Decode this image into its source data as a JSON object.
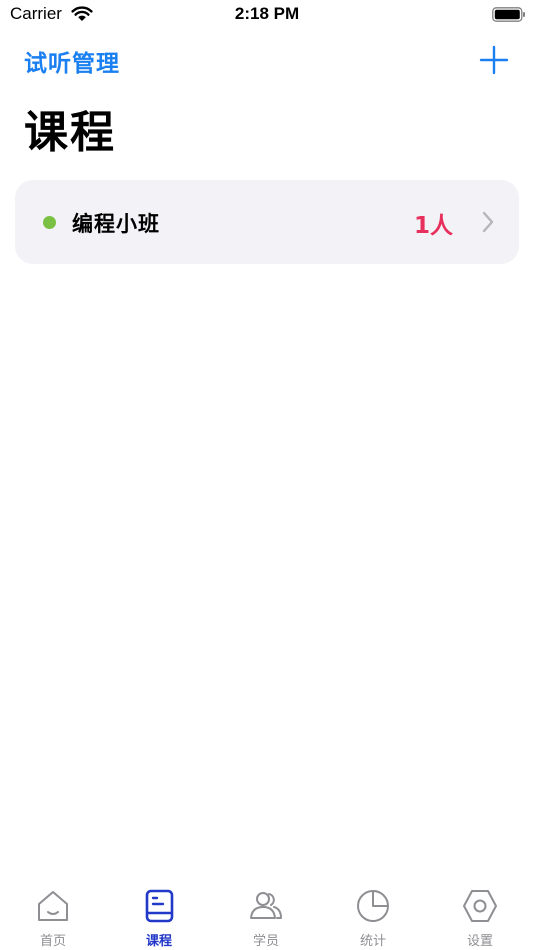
{
  "status_bar": {
    "carrier": "Carrier",
    "time": "2:18 PM"
  },
  "nav": {
    "back_label": "试听管理",
    "add_icon": "plus-icon"
  },
  "page": {
    "title": "课程"
  },
  "courses": [
    {
      "name": "编程小班",
      "count": "1人",
      "status_color": "#7ac143",
      "count_color": "#e8305c"
    }
  ],
  "tabs": [
    {
      "label": "首页",
      "icon": "home-icon",
      "active": false
    },
    {
      "label": "课程",
      "icon": "book-icon",
      "active": true
    },
    {
      "label": "学员",
      "icon": "users-icon",
      "active": false
    },
    {
      "label": "统计",
      "icon": "pie-chart-icon",
      "active": false
    },
    {
      "label": "设置",
      "icon": "hexagon-gear-icon",
      "active": false
    }
  ],
  "colors": {
    "accent": "#1a7ff0",
    "tab_active": "#2238c9",
    "tab_inactive": "#8e8e93",
    "card_bg": "#f2f2f7"
  }
}
